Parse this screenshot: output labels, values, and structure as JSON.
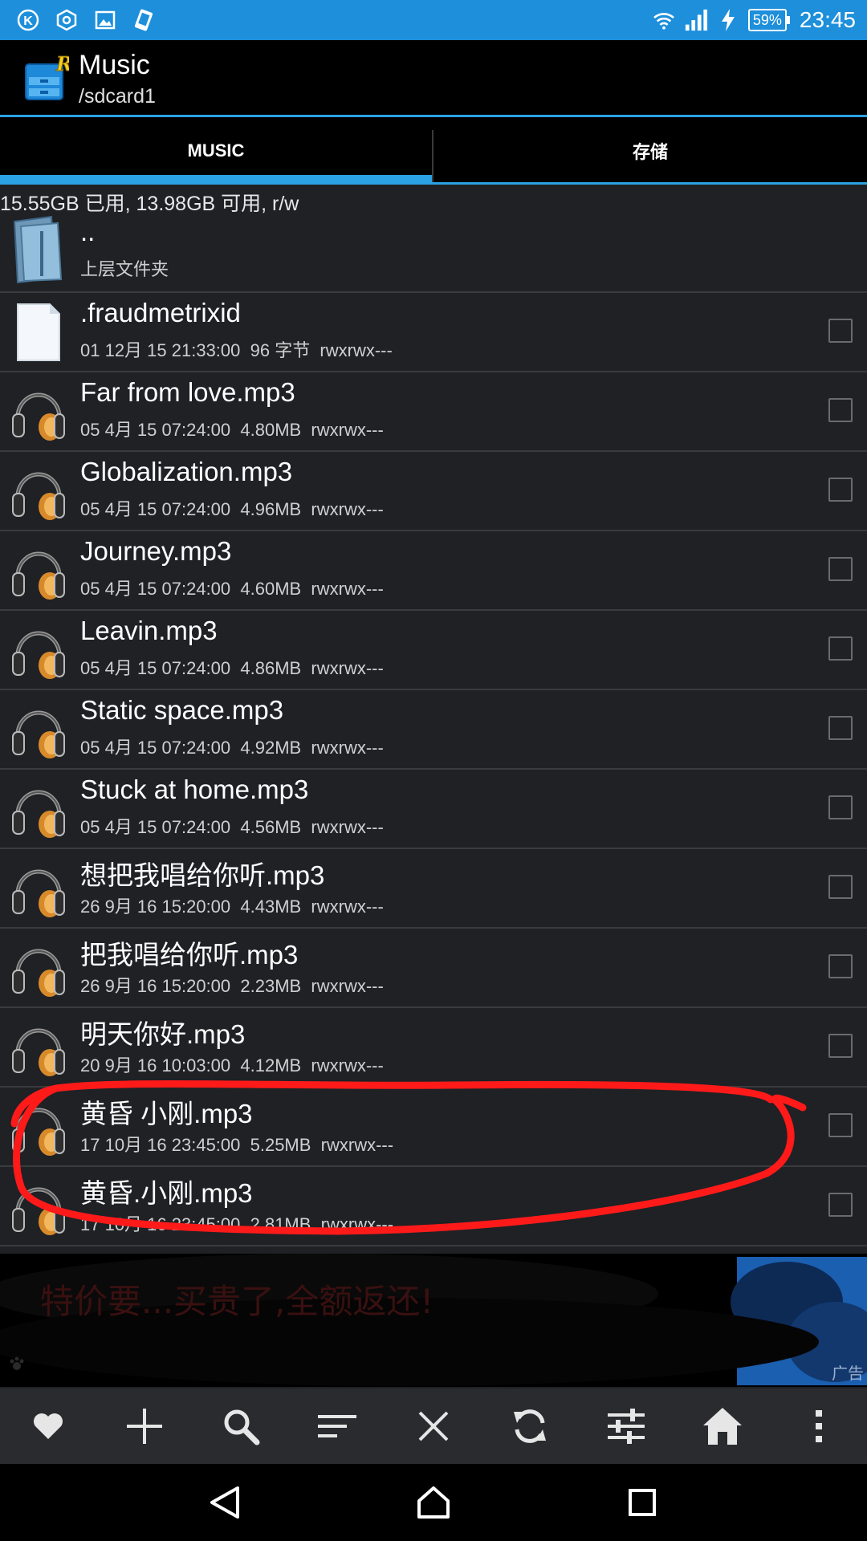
{
  "status_bar": {
    "battery": "59%",
    "time": "23:45"
  },
  "header": {
    "title": "Music",
    "path": "/sdcard1"
  },
  "tabs": [
    {
      "label": "MUSIC",
      "active": true
    },
    {
      "label": "存储",
      "active": false
    }
  ],
  "storage_info": "15.55GB 已用, 13.98GB 可用, r/w",
  "parent": {
    "name": "..",
    "label": "上层文件夹"
  },
  "files": [
    {
      "name": ".fraudmetrixid",
      "meta": "01 12月 15 21:33:00  96 字节  rwxrwx---",
      "type": "file"
    },
    {
      "name": "Far from love.mp3",
      "meta": "05 4月 15 07:24:00  4.80MB  rwxrwx---",
      "type": "audio"
    },
    {
      "name": "Globalization.mp3",
      "meta": "05 4月 15 07:24:00  4.96MB  rwxrwx---",
      "type": "audio"
    },
    {
      "name": "Journey.mp3",
      "meta": "05 4月 15 07:24:00  4.60MB  rwxrwx---",
      "type": "audio"
    },
    {
      "name": "Leavin.mp3",
      "meta": "05 4月 15 07:24:00  4.86MB  rwxrwx---",
      "type": "audio"
    },
    {
      "name": "Static space.mp3",
      "meta": "05 4月 15 07:24:00  4.92MB  rwxrwx---",
      "type": "audio"
    },
    {
      "name": "Stuck at home.mp3",
      "meta": "05 4月 15 07:24:00  4.56MB  rwxrwx---",
      "type": "audio"
    },
    {
      "name": "想把我唱给你听.mp3",
      "meta": "26 9月 16 15:20:00  4.43MB  rwxrwx---",
      "type": "audio"
    },
    {
      "name": "把我唱给你听.mp3",
      "meta": "26 9月 16 15:20:00  2.23MB  rwxrwx---",
      "type": "audio"
    },
    {
      "name": "明天你好.mp3",
      "meta": "20 9月 16 10:03:00  4.12MB  rwxrwx---",
      "type": "audio"
    },
    {
      "name": "黄昏   小刚.mp3",
      "meta": "17 10月 16 23:45:00  5.25MB  rwxrwx---",
      "type": "audio"
    },
    {
      "name": "黄昏.小刚.mp3",
      "meta": "17 10月 16 23:45:00  2.81MB  rwxrwx---",
      "type": "audio"
    }
  ],
  "ad": {
    "text": "特价要...买贵了,全额返还!",
    "badge": "广告"
  },
  "toolbar": [
    "heart-icon",
    "plus-icon",
    "search-icon",
    "sort-icon",
    "close-icon",
    "refresh-icon",
    "sliders-icon",
    "home-icon",
    "more-icon"
  ],
  "colors": {
    "status_bar": "#1d8fdb",
    "accent": "#2aa2e4",
    "background": "#1f2125",
    "annotation": "#ff1a1a"
  }
}
